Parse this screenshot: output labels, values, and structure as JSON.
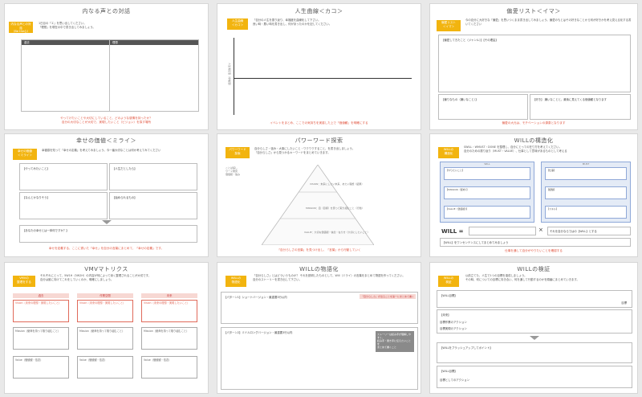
{
  "panels": {
    "p1": {
      "title": "内なる声との対話",
      "tag": "内なる声との対話\n（Be the心）",
      "desc": "1日目の「エ」を思い出してください。\n「理想」を現在の中で書き出してみましょう。",
      "box_left": "過去",
      "box_right_tag": "未来",
      "box_right": "理想",
      "box_right_tag2": "7年",
      "note": "やってけたいことや大切にしていること、どのような感情を持ったか？\n自分の大切なことが大切で、実現したいこと（ビジョン）を探す場所"
    },
    "p2": {
      "title": "人生曲線＜カコ＞",
      "tag": "人生曲線\n＜カコ＞",
      "desc": "「自分の人生を振り返り、幸福度を曲線化して下さい。\n良い時・悪い時を書き出し、何があったのかを記してください。",
      "ylabel": "人生満足度（幸福度）",
      "note": "イベントをまとめ、ここでの気持ちを実感した上で「価値観」を明確にする"
    },
    "p3": {
      "title": "偏愛リスト＜イマ＞",
      "tag": "偏愛リスト\n＜イマ＞",
      "desc": "今の自分に大好きな「偏愛」を思いつくまま書き出してみましょう。偏愛のもとはその好きなことから何が好きかを考え見える化する書いてください",
      "box1": "【偏愛してきたこと（ジャンル）】【その理由】",
      "box2": "【偏りなもの（嫌いなこと）】",
      "box3": "【好き】 嫌いなことと、最後に見えてくる価値観となります",
      "note": "偏愛の大元は、モチベーションの源泉となります"
    },
    "p4": {
      "title": "幸せの価値＜ミライ＞",
      "tag": "幸せの価値\n＜ミライ＞",
      "desc": "幸福感を知って「幸せの定義」を考えてみましょう。今一番大切なことは何か考えてみてください",
      "q1": "【やってみたいこと】",
      "q2": "【人生だとしたら】",
      "q3": "【なんとかなりそう】",
      "q4": "【始められるもの】",
      "q5": "【あなたの幸せとは一体何ですか？】",
      "note": "幸せを定義する、ここに書いた「幸せ」を自分の言葉にまとめて、「幸せの定義」です。"
    },
    "p5": {
      "title": "パワーワード探索",
      "tag": "パワーワード\n探索",
      "desc": "自分らしさ・強み・大事にしたいこと・ワクワクすること、を書き出しましょう。\n『自分らしさ』から見つかるキーワードをまとめていきます。",
      "side": "ことば探し\nワード発見\n価値観・強み",
      "vision": "VISION：未来にしたい未来、あたい理想（結果）",
      "mission": "MISSION：自（目標）を意って取り組むこと（行動）",
      "value": "VALUE：大切な価値観・信念・在り方（大切にしたいこと）",
      "note": "「自分らしさの言葉」を見つけ出し、「言葉」から行動していく"
    },
    "p6": {
      "title": "WILLの構造化",
      "tag": "WILLの\n構造化",
      "desc": "SWILL・WMUST・DONE を整理し、自分にとっての在り方を考えてください。\n自分のための振り返り（MUST・VALUE）、仕事として意味があるものとして考える",
      "will": "WILL",
      "must": "MUST",
      "rows": [
        "【やりたいこと】",
        "【MISSION（使命）】",
        "【VALUE（価値観）】"
      ],
      "right_rows": [
        "【仕事】",
        "【経験】",
        "【スキル】"
      ],
      "formula_left": "WILL =",
      "times": "×",
      "formula_box": "それを自分ならではの【WILL】とする",
      "bottom": "【WILL】をワンセンテンスにしてまとめてみましょう",
      "note": "仕事を通して自分がやりたいことを確認する"
    },
    "p7": {
      "title": "VMVマトリクス",
      "tag": "VMVの\n整理をする",
      "desc": "それぞれにとって、5W1H（5W2H）の内容が何によって深く整理されることが大切です。\n自分は誰に向けてこれをしていくのか、明確にしましょう。",
      "cols": [
        "過去",
        "作業空間",
        "未来"
      ],
      "vision": [
        "Vision（未来の理想・実現したいこと）",
        "Vision（未来の理想・実現したいこと）",
        "Vision（未来の理想・実現したいこと）"
      ],
      "mission": [
        "Mission（使命を持って取り組むこと）",
        "Mission（使命を持って取り組むこと）",
        "Mission（使命を持って取り組むこと）"
      ],
      "value": [
        "Value（価値観・信念）",
        "Value（価値観・信念）",
        "Value（価値観・信念）"
      ]
    },
    "p8": {
      "title": "WILLの物語化",
      "tag": "WILLの\n物語化",
      "desc": "「自分らしさ」とはどういうものか？ それを説明したものとして、Will（ミライ）の言葉をまとめて物語を作ってください。\n自分のストーリーを書き出して下さい。",
      "box1": "【パターン1】ショートバージョン・最重要3行以内",
      "box1_tag": "「自分らしさ」が出ることを第一にまとめて書く",
      "box2": "【パターン2】ミドルロングバージョン・最重要3行以内",
      "gray": "ストーリーは読み手が理解しやすく、\n読み手・聞き手に伝えたいことを\nまとめて書くこと"
    },
    "p9": {
      "title": "WILLの検証",
      "tag": "WILLの\n検証",
      "desc": "以前立てた、人生で1つの目標を達成しましょう。\nその時、何についての目標に向き合い、何を通して行動するのかを順番にまとめていきます。",
      "r1": "【WILL目標】",
      "r1v": "目標",
      "r2": "【未来】",
      "r2a": "目標作業のアクション",
      "r2b": "目標実現のアクション",
      "r3": "【WILLをブラッシュアップしてポイント】",
      "r4": "【WILL目標】",
      "r4v": "目標としてのアクション"
    }
  },
  "colors": {
    "accent": "#f2b40f",
    "red": "#e0513b",
    "blue": "#8fa8d8"
  }
}
